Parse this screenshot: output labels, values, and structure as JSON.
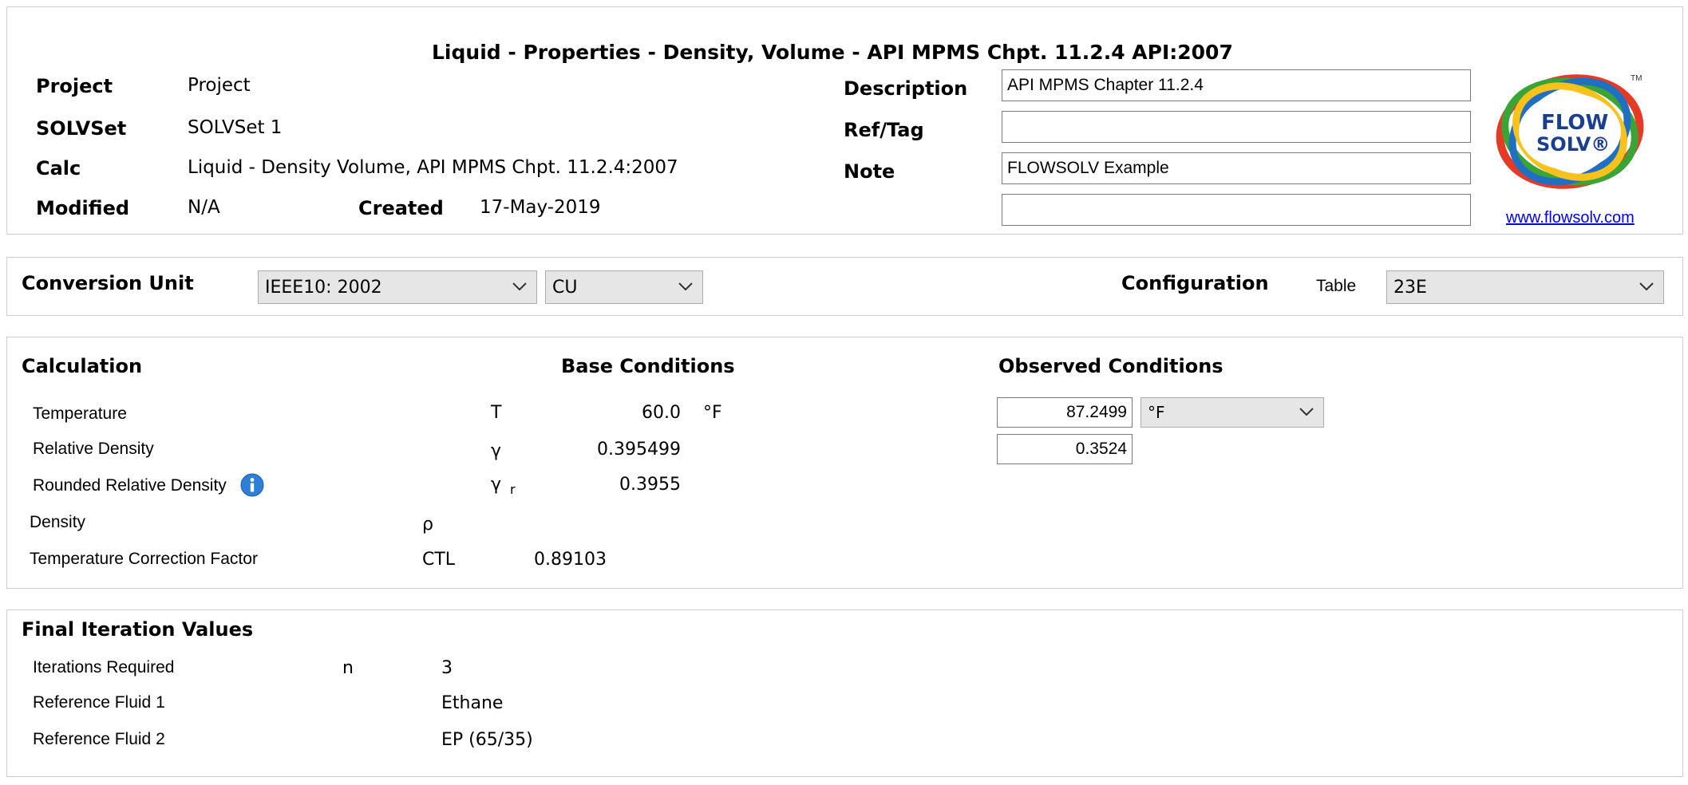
{
  "header": {
    "title": "Liquid - Properties - Density, Volume - API MPMS Chpt. 11.2.4 API:2007",
    "project_label": "Project",
    "project_value": "Project",
    "solvset_label": "SOLVSet",
    "solvset_value": "SOLVSet 1",
    "calc_label": "Calc",
    "calc_value": "Liquid - Density Volume, API MPMS Chpt. 11.2.4:2007",
    "modified_label": "Modified",
    "modified_value": "N/A",
    "created_label": "Created",
    "created_value": "17-May-2019",
    "description_label": "Description",
    "description_value": "API MPMS Chapter 11.2.4",
    "reftag_label": "Ref/Tag",
    "reftag_value": "",
    "note_label": "Note",
    "note_value": "FLOWSOLV Example",
    "extra_value": "",
    "logo_text_line1": "FLOW",
    "logo_text_line2": "SOLV®",
    "logo_tm": "TM",
    "website": "www.flowsolv.com"
  },
  "conversion": {
    "label": "Conversion Unit",
    "standard_selected": "IEEE10: 2002",
    "unit_selected": "CU",
    "configuration_label": "Configuration",
    "table_label": "Table",
    "table_selected": "23E"
  },
  "calculation": {
    "heading": "Calculation",
    "base_heading": "Base Conditions",
    "observed_heading": "Observed Conditions",
    "temperature_label": "Temperature",
    "temperature_symbol": "T",
    "temperature_base": "60.0",
    "temperature_base_unit": "°F",
    "temperature_observed": "87.2499",
    "temperature_observed_unit": "°F",
    "rel_density_label": "Relative Density",
    "rel_density_symbol": "γ",
    "rel_density_base": "0.395499",
    "rel_density_observed": "0.3524",
    "rounded_rel_density_label": "Rounded Relative Density",
    "rounded_symbol": "γ",
    "rounded_symbol_sub": "r",
    "rounded_rel_density_base": "0.3955",
    "density_label": "Density",
    "density_symbol": "ρ",
    "ctf_label": "Temperature Correction Factor",
    "ctf_symbol": "CTL",
    "ctf_value": "0.89103"
  },
  "final": {
    "heading": "Final Iteration Values",
    "iterations_label": "Iterations Required",
    "iterations_symbol": "n",
    "iterations_value": "3",
    "ref1_label": "Reference Fluid 1",
    "ref1_value": "Ethane",
    "ref2_label": "Reference Fluid 2",
    "ref2_value": "EP (65/35)"
  },
  "colors": {
    "panel_border": "#cfcfcf",
    "combo_bg": "#e6e6e6",
    "link": "#0000ee",
    "info_icon": "#2f7fd6"
  }
}
